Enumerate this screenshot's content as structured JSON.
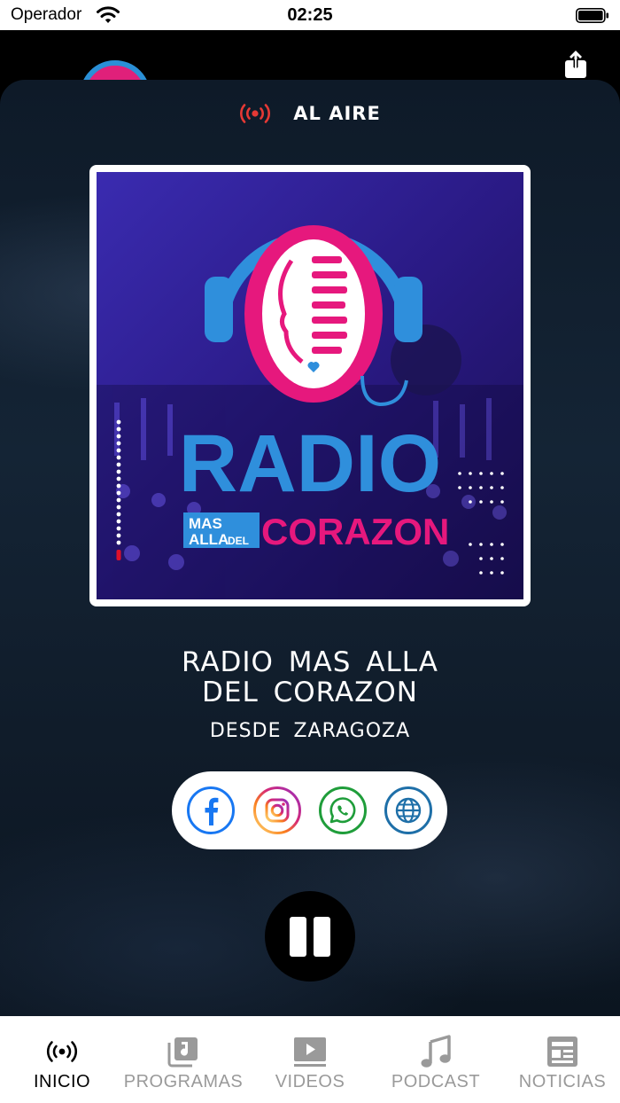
{
  "status_bar": {
    "carrier": "Operador",
    "time": "02:25"
  },
  "live": {
    "label": "AL AIRE",
    "color": "#e53935"
  },
  "cover": {
    "word_radio": "RADIO",
    "word_mas": "MAS",
    "word_alla": "ALLA",
    "word_del": "DEL",
    "word_corazon": "CORAZON",
    "colors": {
      "blue": "#2f8fdc",
      "pink": "#e6187d",
      "purple": "#3a1d9e"
    }
  },
  "station": {
    "name": "RADIO MAS ALLA\nDEL CORAZON",
    "subtitle": "DESDE ZARAGOZA"
  },
  "social": [
    {
      "name": "facebook-icon",
      "color": "#1877f2"
    },
    {
      "name": "instagram-icon",
      "color": "#d62976"
    },
    {
      "name": "whatsapp-icon",
      "color": "#1f9d3a"
    },
    {
      "name": "globe-icon",
      "color": "#1e6fa8"
    }
  ],
  "player": {
    "state": "playing",
    "button_icon": "pause-icon"
  },
  "tabs": [
    {
      "label": "INICIO",
      "icon": "broadcast-icon",
      "active": true
    },
    {
      "label": "PROGRAMAS",
      "icon": "music-library-icon",
      "active": false
    },
    {
      "label": "VIDEOS",
      "icon": "play-video-icon",
      "active": false
    },
    {
      "label": "PODCAST",
      "icon": "music-note-icon",
      "active": false
    },
    {
      "label": "NOTICIAS",
      "icon": "news-icon",
      "active": false
    }
  ],
  "tab_colors": {
    "active": "#000000",
    "inactive": "#9a9a9a"
  }
}
